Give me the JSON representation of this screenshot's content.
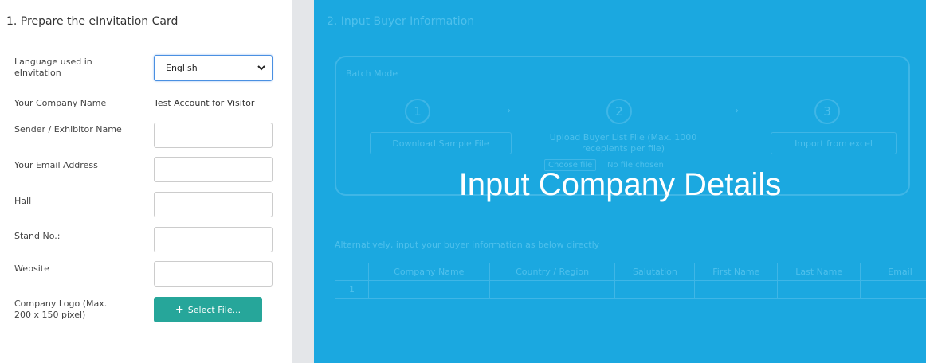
{
  "prepare_card": {
    "title": "1. Prepare the eInvitation Card",
    "language_label": "Language used in eInvitation",
    "language_value": "English",
    "company_name_label": "Your Company Name",
    "company_name_value": "Test Account for Visitor",
    "sender_label": "Sender / Exhibitor Name",
    "email_label": "Your Email Address",
    "hall_label": "Hall",
    "stand_label": "Stand No.:",
    "website_label": "Website",
    "logo_label": "Company Logo (Max. 200 x 150 pixel)",
    "select_file_label": "Select File...",
    "select_file_color": "#26a69a"
  },
  "buyer_info": {
    "title": "2. Input Buyer Information",
    "batch_title": "Batch Mode",
    "steps": [
      "1",
      "2",
      "3"
    ],
    "download_label": "Download Sample File",
    "upload_label": "Upload Buyer List File (Max. 1000 recepients per file)",
    "choose_file_label": "Choose file",
    "no_file_label": "No file chosen",
    "import_label": "Import from excel",
    "alternative_text": "Alternatively, input your buyer information as below directly",
    "table_headers": [
      "Company Name",
      "Country / Region",
      "Salutation",
      "First Name",
      "Last Name",
      "Email"
    ],
    "first_row_index": "1",
    "overlay_color": "#1ba8e0"
  },
  "overlay": {
    "heading": "Input Company Details"
  }
}
